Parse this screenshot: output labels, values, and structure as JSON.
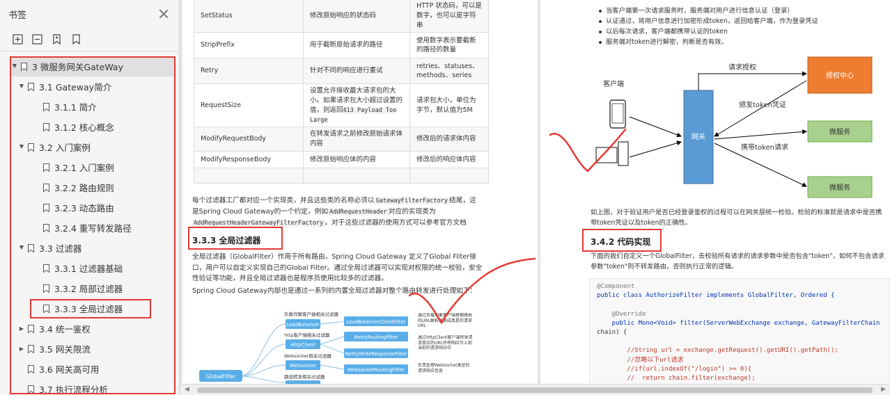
{
  "sidebar": {
    "title": "书签",
    "toolbar_icons": [
      "expand-all-icon",
      "collapse-all-icon",
      "add-bookmark-icon",
      "bookmark-icon"
    ],
    "items": [
      {
        "label": "3 微服务网关GateWay",
        "level": 0,
        "toggle": "▲"
      },
      {
        "label": "3.1 Gateway简介",
        "level": 1,
        "toggle": "▲"
      },
      {
        "label": "3.1.1 简介",
        "level": 2,
        "toggle": ""
      },
      {
        "label": "3.1.2 核心概念",
        "level": 2,
        "toggle": ""
      },
      {
        "label": "3.2 入门案例",
        "level": 1,
        "toggle": "▲"
      },
      {
        "label": "3.2.1 入门案例",
        "level": 2,
        "toggle": ""
      },
      {
        "label": "3.2.2 路由规则",
        "level": 2,
        "toggle": ""
      },
      {
        "label": "3.2.3 动态路由",
        "level": 2,
        "toggle": ""
      },
      {
        "label": "3.2.4 重写转发路径",
        "level": 2,
        "toggle": ""
      },
      {
        "label": "3.3 过滤器",
        "level": 1,
        "toggle": "▲"
      },
      {
        "label": "3.3.1 过滤器基础",
        "level": 2,
        "toggle": ""
      },
      {
        "label": "3.3.2 局部过滤器",
        "level": 2,
        "toggle": ""
      },
      {
        "label": "3.3.3 全局过滤器",
        "level": 2,
        "toggle": "",
        "selected": true
      },
      {
        "label": "3.4 统一鉴权",
        "level": 1,
        "toggle": "▶"
      },
      {
        "label": "3.5 网关限流",
        "level": 1,
        "toggle": "▶"
      },
      {
        "label": "3.6 网关高可用",
        "level": 1,
        "toggle": ""
      },
      {
        "label": "3.7 执行流程分析",
        "level": 1,
        "toggle": ""
      }
    ]
  },
  "page1": {
    "table_rows": [
      {
        "name": "SetStatus",
        "effect": "修改原始响应的状态码",
        "param": "HTTP 状态码，可以是数字，也可以是字符串"
      },
      {
        "name": "StripPrefix",
        "effect": "用于截断原始请求的路径",
        "param": "使用数字表示要截断的路径的数量"
      },
      {
        "name": "Retry",
        "effect": "针对不同的响应进行重试",
        "param": "retries、statuses、methods、series"
      },
      {
        "name": "RequestSize",
        "effect": "设置允许接收最大请求包的大小。如果请求包大小超过设置的值，则返回",
        "effect_code": "413 Payload Too Large",
        "param": "请求包大小，单位为字节，默认值为5M"
      },
      {
        "name": "ModifyRequestBody",
        "effect": "在转发请求之前修改原始请求体内容",
        "param": "修改后的请求体内容"
      },
      {
        "name": "ModifyResponseBody",
        "effect": "修改原始响应体的内容",
        "param": "修改后的响应体内容"
      }
    ],
    "para1_a": "每个过滤器工厂都对应一个实现类，并且这些类的名称必须以",
    "para1_code1": "GatewayFilterFactory",
    "para1_b": "结尾，这是Spring Cloud Gateway的一个约定，例如",
    "para1_code2": "AddRequestHeader",
    "para1_c": "对应的实现类为",
    "para1_code3": "AddRequestHeaderGatewayFilterFactory",
    "para1_d": "。对于这些过滤器的使用方式可以参考官方文档",
    "heading": "3.3.3 全局过滤器",
    "para2": "全局过滤器（GlobalFilter）作用于所有路由，Spring Cloud Gateway 定义了Global Filter接口，用户可以自定义实现自己的Global Filter。通过全局过滤器可以实现对权限的统一校验，安全性验证等功能，并且全局过滤器也是程序员使用比较多的过滤器。",
    "para3": "Spring Cloud Gateway内部也是通过一系列的内置全局过滤器对整个路由转发进行处理如下：",
    "diagram": {
      "root": "GlobalFilter",
      "groups": [
        {
          "caption": "负载均衡客户端相关过滤器",
          "node": "LoadBalancer",
          "leaf": "LoadBalancerClientFilter",
          "note": "通过负载均衡客户端根据路由的URL解析转换成真是的请求URL"
        },
        {
          "caption": "http客户端相关过滤器",
          "node": "HttpClient",
          "leaf": "NettyRoutingFilter",
          "leaf2": "NettyWriteResponseFilter",
          "note": "通过HttpClient客户端转发请求真实的URL并将响应写入到当前的请求响应中"
        },
        {
          "caption": "Websocket相关过滤器",
          "node": "Websocket",
          "leaf": "WebsocketRoutingFilter",
          "note": "负责处理Websocket类型的请求响应信息"
        },
        {
          "caption": "路径转发相关过滤器",
          "node": "",
          "leaf": "",
          "note": ""
        }
      ]
    }
  },
  "page2": {
    "bullets": [
      "当客户端第一次请求服务时，服务端对用户进行信息认证（登录）",
      "认证通过，将用户信息进行加密形成token，返回给客户端，作为登录凭证",
      "以后每次请求，客户端都携带认证的token",
      "服务端对token进行解密，判断是否有效。"
    ],
    "diagram": {
      "client_label": "客户端",
      "gateway_label": "网关",
      "auth_label": "授权中心",
      "service_label_1": "微服务",
      "service_label_2": "微服务",
      "edge_request_auth": "请求授权",
      "edge_issue_token": "颁发token凭证",
      "edge_carry_token": "携带token请求",
      "colors": {
        "gateway": "#5a9bd5",
        "auth": "#ed7d31",
        "service": "#a9d18e"
      }
    },
    "para1": "如上图，对于验证用户是否已经登录鉴权的过程可以在网关层统一检验。检验的标准就是请求中是否携带token凭证以及token的正确性。",
    "heading": "3.4.2 代码实现",
    "para2": "下面的我们自定义一个GlobalFilter，去校验所有请求的请求参数中是否包含\"token\"，如何不包含请求参数\"token\"则不转发路由，否则执行正常的逻辑。",
    "code_lines": [
      "@Component",
      "public class AuthorizeFilter implements GlobalFilter, Ordered {",
      "",
      "    @Override",
      "    public Mono<Void> filter(ServerWebExchange exchange, GatewayFilterChain",
      "chain) {",
      "",
      "        //String url = exchange.getRequest().getURI().getPath();",
      "        //忽略以下url请求",
      "        //if(url.indexOf(\"/login\") >= 0){",
      "        //  return chain.filter(exchange);"
    ]
  },
  "annotation_color": "#e53935"
}
